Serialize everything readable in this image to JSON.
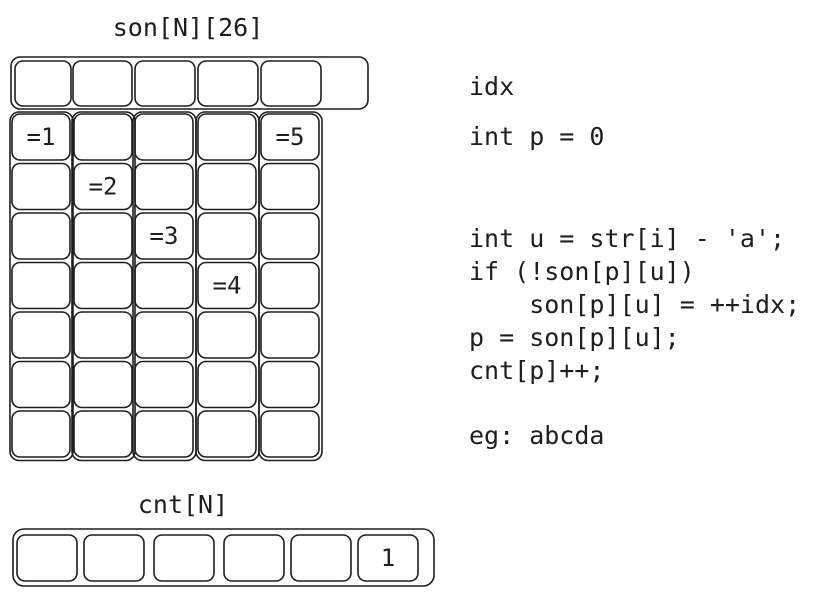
{
  "son": {
    "title": "son[N][26]",
    "marks": [
      {
        "row": 0,
        "col": 0,
        "label": "=1"
      },
      {
        "row": 1,
        "col": 1,
        "label": "=2"
      },
      {
        "row": 2,
        "col": 2,
        "label": "=3"
      },
      {
        "row": 3,
        "col": 3,
        "label": "=4"
      },
      {
        "row": 0,
        "col": 4,
        "label": "=5"
      }
    ]
  },
  "cnt": {
    "title": "cnt[N]",
    "values": [
      "",
      "",
      "",
      "",
      "",
      "1"
    ]
  },
  "code": {
    "idx_label": "idx",
    "p_init": "int p = 0",
    "loop_lines": [
      "int u = str[i] - 'a';",
      "if (!son[p][u])",
      "    son[p][u] = ++idx;",
      "p = son[p][u];",
      "cnt[p]++;"
    ],
    "example": "eg: abcda"
  }
}
